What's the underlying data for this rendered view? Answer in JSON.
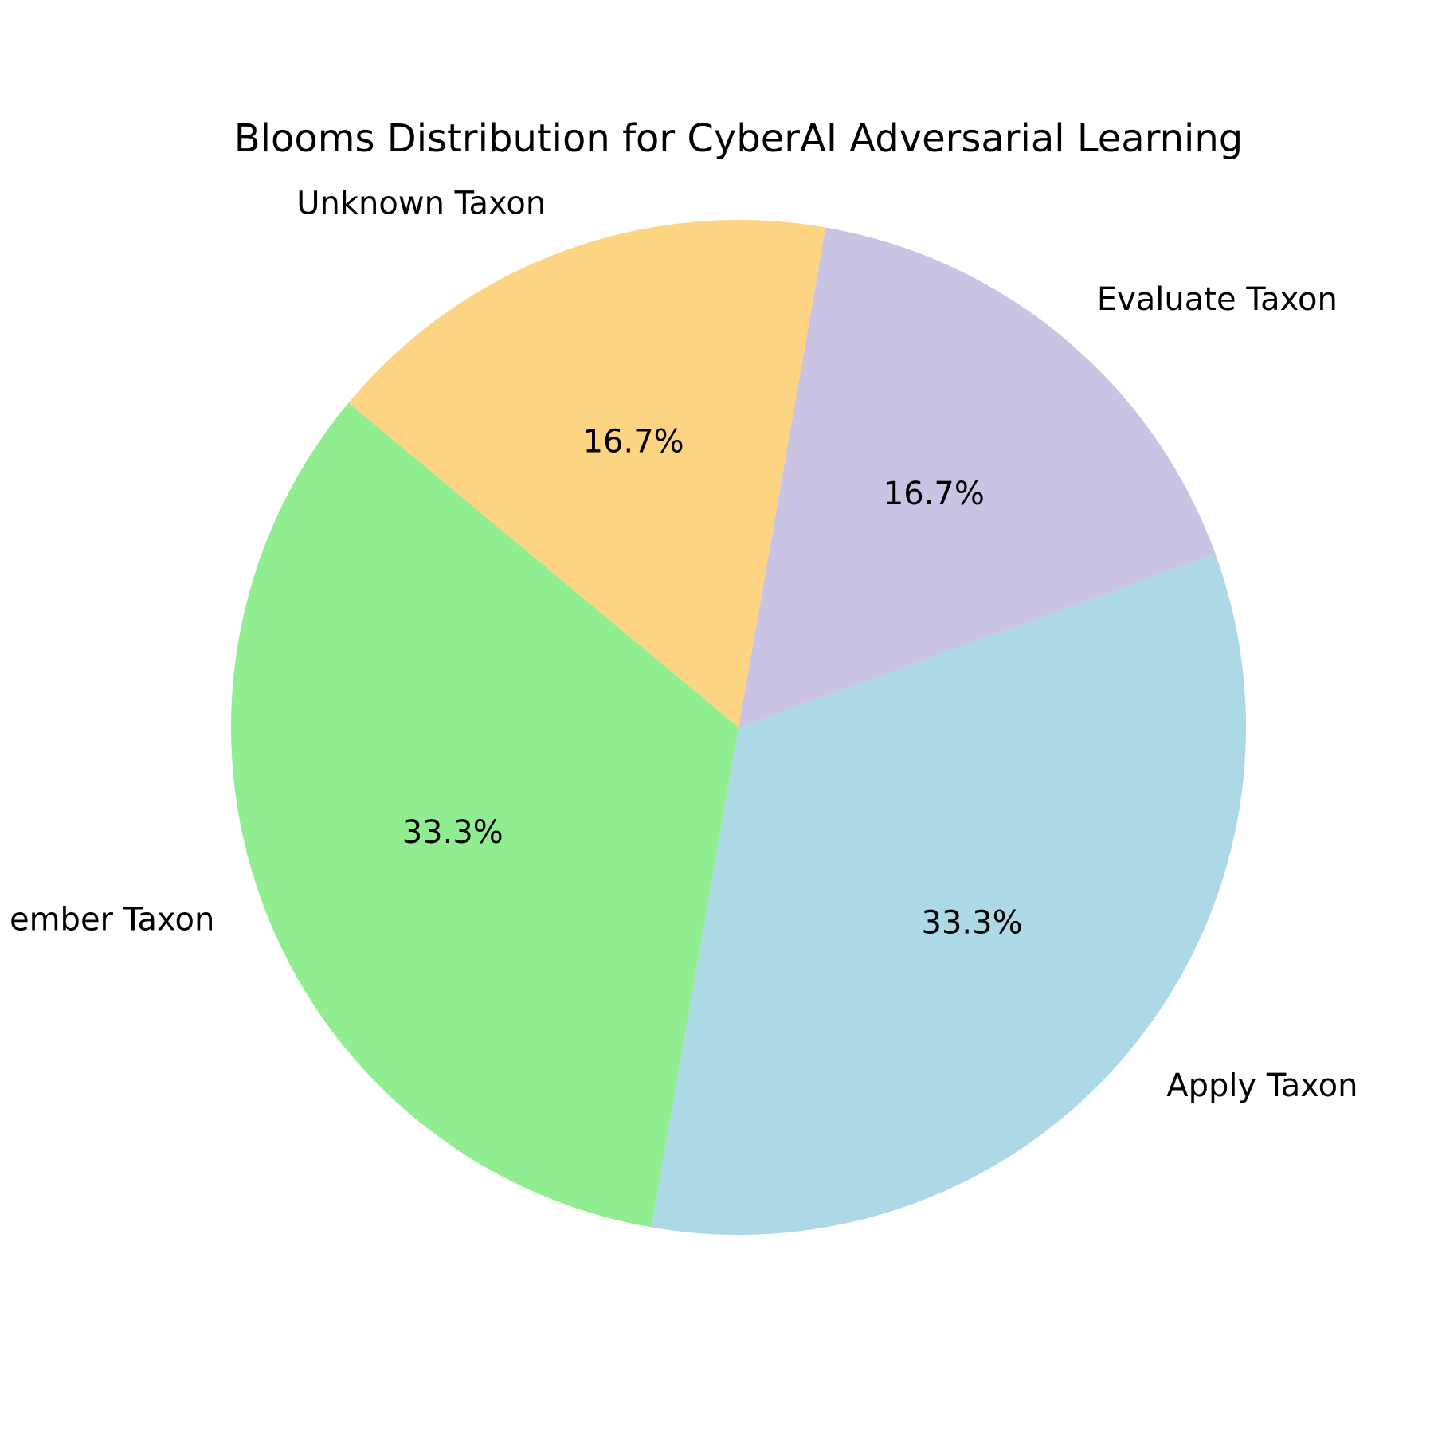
{
  "chart_data": {
    "type": "pie",
    "title": "Blooms Distribution for CyberAI Adversarial Learning",
    "slices": [
      {
        "label": "Evaluate Taxon",
        "value": 16.7,
        "pct_label": "16.7%",
        "color": "#cbc3e3"
      },
      {
        "label": "Unknown Taxon",
        "value": 16.7,
        "pct_label": "16.7%",
        "color": "#fdd582"
      },
      {
        "label": "ember Taxon",
        "value": 33.3,
        "pct_label": "33.3%",
        "color": "#90ee90"
      },
      {
        "label": "Apply Taxon",
        "value": 33.3,
        "pct_label": "33.3%",
        "color": "#add8e6"
      }
    ],
    "start_angle_deg": 20,
    "direction": "counterclockwise"
  }
}
